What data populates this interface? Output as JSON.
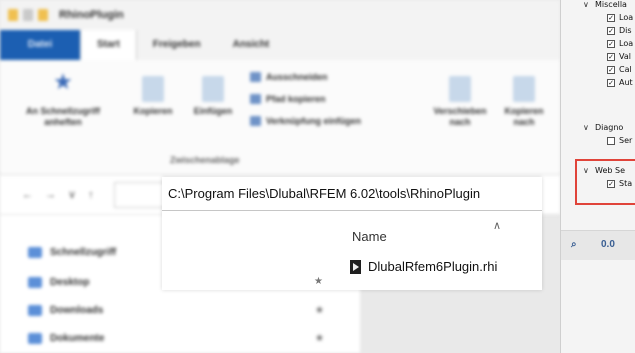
{
  "window": {
    "title": "RhinoPlugin"
  },
  "ribbon": {
    "tabs": [
      "Datei",
      "Start",
      "Freigeben",
      "Ansicht"
    ],
    "buttons": {
      "pin": "An Schnellzugriff anheften",
      "copy": "Kopieren",
      "paste": "Einfügen",
      "move_to": "Verschieben nach",
      "copy_to": "Kopieren nach"
    },
    "small_actions": [
      "Ausschneiden",
      "Pfad kopieren",
      "Verknüpfung einfügen"
    ],
    "group_label": "Zwischenablage"
  },
  "address_bar": {
    "path": "C:\\Program Files\\Dlubal\\RFEM 6.02\\tools\\RhinoPlugin"
  },
  "file_list": {
    "column_header": "Name",
    "files": [
      {
        "name": "DlubalRfem6Plugin.rhi"
      }
    ]
  },
  "nav_pane": {
    "items": [
      "Schnellzugriff",
      "Desktop",
      "Downloads",
      "Dokumente"
    ]
  },
  "settings_panel": {
    "section_misc": "Miscella",
    "misc_items": [
      "Loa",
      "Dis",
      "Loa",
      "Val",
      "Cal",
      "Aut"
    ],
    "section_diag": "Diagno",
    "diag_item": "Ser",
    "section_web": "Web Se",
    "web_item": "Sta"
  },
  "colors": {
    "accent": "#1c5fb2",
    "highlight_border": "#e0443a"
  }
}
